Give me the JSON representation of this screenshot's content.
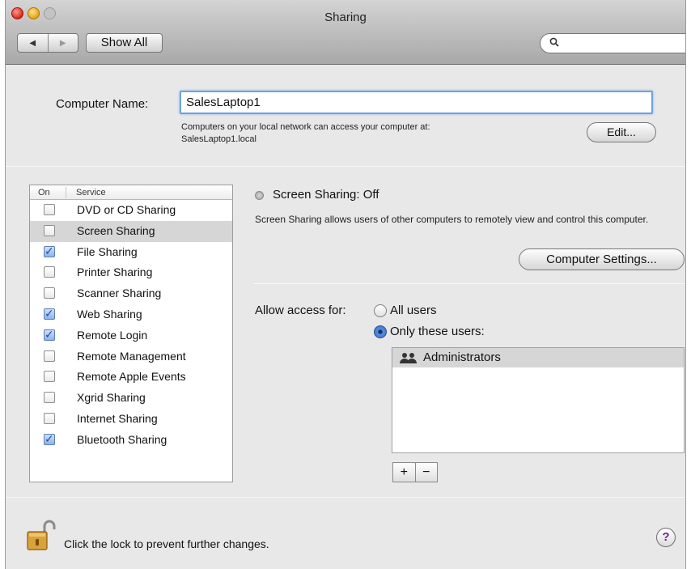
{
  "window": {
    "title": "Sharing"
  },
  "toolbar": {
    "show_all_label": "Show All",
    "search_placeholder": "",
    "back_icon": "◀",
    "forward_icon": "▶"
  },
  "computer_name": {
    "label": "Computer Name:",
    "value": "SalesLaptop1",
    "help_line1": "Computers on your local network can access your computer at:",
    "help_line2": "SalesLaptop1.local",
    "edit_label": "Edit..."
  },
  "services": {
    "col_on": "On",
    "col_service": "Service",
    "items": [
      {
        "label": "DVD or CD Sharing",
        "on": false,
        "selected": false
      },
      {
        "label": "Screen Sharing",
        "on": false,
        "selected": true
      },
      {
        "label": "File Sharing",
        "on": true,
        "selected": false
      },
      {
        "label": "Printer Sharing",
        "on": false,
        "selected": false
      },
      {
        "label": "Scanner Sharing",
        "on": false,
        "selected": false
      },
      {
        "label": "Web Sharing",
        "on": true,
        "selected": false
      },
      {
        "label": "Remote Login",
        "on": true,
        "selected": false
      },
      {
        "label": "Remote Management",
        "on": false,
        "selected": false
      },
      {
        "label": "Remote Apple Events",
        "on": false,
        "selected": false
      },
      {
        "label": "Xgrid Sharing",
        "on": false,
        "selected": false
      },
      {
        "label": "Internet Sharing",
        "on": false,
        "selected": false
      },
      {
        "label": "Bluetooth Sharing",
        "on": true,
        "selected": false
      }
    ]
  },
  "detail": {
    "status": "Screen Sharing: Off",
    "description": "Screen Sharing allows users of other computers to remotely view and control this computer.",
    "settings_button": "Computer Settings...",
    "allow_label": "Allow access for:",
    "option_all": "All users",
    "option_only": "Only these users:",
    "selected_option": "only",
    "users": [
      "Administrators"
    ],
    "add_label": "+",
    "remove_label": "−"
  },
  "footer": {
    "lock_text": "Click the lock to prevent further changes.",
    "help_label": "?"
  },
  "colors": {
    "accent": "#2f6fd1",
    "selection": "#d6d6d6"
  }
}
